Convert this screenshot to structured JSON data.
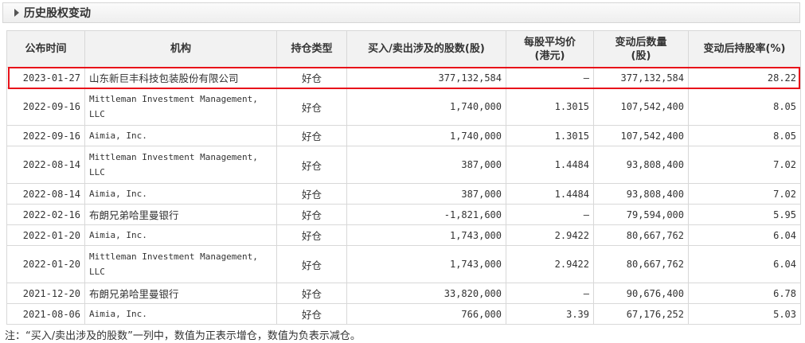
{
  "section": {
    "title": "历史股权变动"
  },
  "table": {
    "headers": {
      "date": "公布时间",
      "org": "机构",
      "type": "持仓类型",
      "shares": "买入/卖出涉及的股数(股)",
      "avg_price_1": "每股平均价",
      "avg_price_2": "(港元)",
      "after_qty_1": "变动后数量",
      "after_qty_2": "(股)",
      "after_pct": "变动后持股率(%)"
    },
    "rows": [
      {
        "date": "2023-01-27",
        "org": "山东新巨丰科技包装股份有限公司",
        "type": "好仓",
        "shares": "377,132,584",
        "avg_price": "—",
        "after_qty": "377,132,584",
        "after_pct": "28.22"
      },
      {
        "date": "2022-09-16",
        "org": "Mittleman Investment Management, LLC",
        "type": "好仓",
        "shares": "1,740,000",
        "avg_price": "1.3015",
        "after_qty": "107,542,400",
        "after_pct": "8.05"
      },
      {
        "date": "2022-09-16",
        "org": "Aimia, Inc.",
        "type": "好仓",
        "shares": "1,740,000",
        "avg_price": "1.3015",
        "after_qty": "107,542,400",
        "after_pct": "8.05"
      },
      {
        "date": "2022-08-14",
        "org": "Mittleman Investment Management, LLC",
        "type": "好仓",
        "shares": "387,000",
        "avg_price": "1.4484",
        "after_qty": "93,808,400",
        "after_pct": "7.02"
      },
      {
        "date": "2022-08-14",
        "org": "Aimia, Inc.",
        "type": "好仓",
        "shares": "387,000",
        "avg_price": "1.4484",
        "after_qty": "93,808,400",
        "after_pct": "7.02"
      },
      {
        "date": "2022-02-16",
        "org": "布朗兄弟哈里曼银行",
        "type": "好仓",
        "shares": "-1,821,600",
        "avg_price": "—",
        "after_qty": "79,594,000",
        "after_pct": "5.95"
      },
      {
        "date": "2022-01-20",
        "org": "Aimia, Inc.",
        "type": "好仓",
        "shares": "1,743,000",
        "avg_price": "2.9422",
        "after_qty": "80,667,762",
        "after_pct": "6.04"
      },
      {
        "date": "2022-01-20",
        "org": "Mittleman Investment Management, LLC",
        "type": "好仓",
        "shares": "1,743,000",
        "avg_price": "2.9422",
        "after_qty": "80,667,762",
        "after_pct": "6.04"
      },
      {
        "date": "2021-12-20",
        "org": "布朗兄弟哈里曼银行",
        "type": "好仓",
        "shares": "33,820,000",
        "avg_price": "—",
        "after_qty": "90,676,400",
        "after_pct": "6.78"
      },
      {
        "date": "2021-08-06",
        "org": "Aimia, Inc.",
        "type": "好仓",
        "shares": "766,000",
        "avg_price": "3.39",
        "after_qty": "67,176,252",
        "after_pct": "5.03"
      }
    ]
  },
  "footnote": "注：“买入/卖出涉及的股数”一列中，数值为正表示增仓，数值为负表示减仓。",
  "colors": {
    "positive": "#e60012",
    "negative": "#009900",
    "highlight_border": "#e8121a"
  }
}
